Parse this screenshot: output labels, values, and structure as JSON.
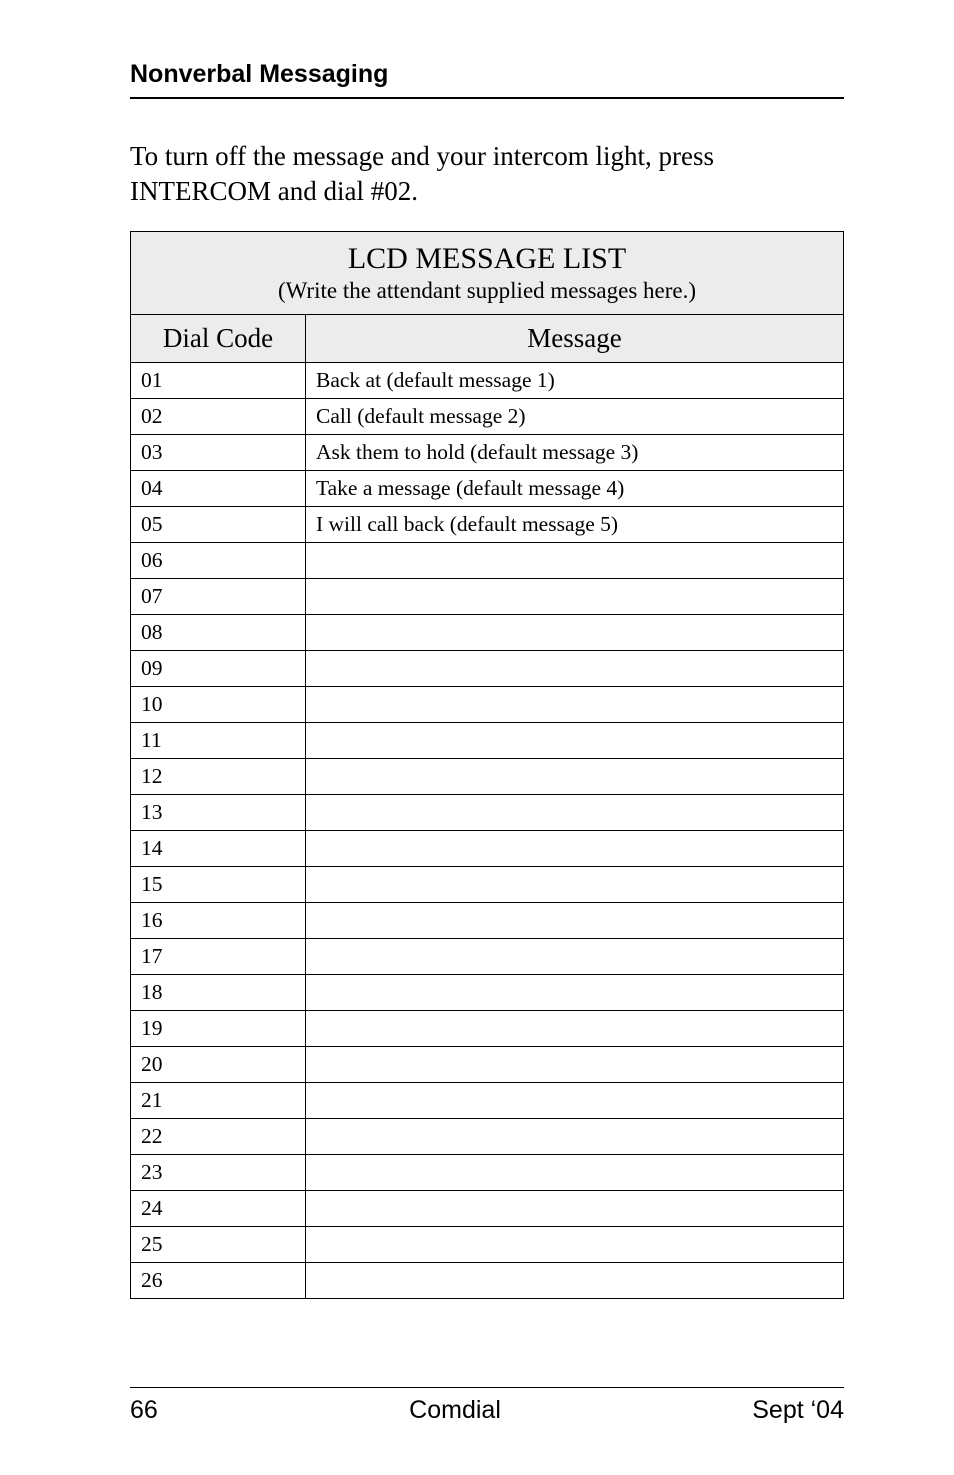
{
  "section_title": "Nonverbal Messaging",
  "intro_text": "To turn off the message and your intercom light, press INTERCOM and dial #02.",
  "table": {
    "title": "LCD MESSAGE LIST",
    "subtitle": "(Write the attendant supplied messages here.)",
    "headers": {
      "dial": "Dial Code",
      "message": "Message"
    },
    "rows": [
      {
        "code": "01",
        "msg": "Back at  (default message 1)"
      },
      {
        "code": "02",
        "msg": "Call  (default message 2)"
      },
      {
        "code": "03",
        "msg": "Ask them to hold  (default message 3)"
      },
      {
        "code": "04",
        "msg": "Take a message  (default message 4)"
      },
      {
        "code": "05",
        "msg": "I will call back  (default message 5)"
      },
      {
        "code": "06",
        "msg": ""
      },
      {
        "code": "07",
        "msg": ""
      },
      {
        "code": "08",
        "msg": ""
      },
      {
        "code": "09",
        "msg": ""
      },
      {
        "code": "10",
        "msg": ""
      },
      {
        "code": "11",
        "msg": ""
      },
      {
        "code": "12",
        "msg": ""
      },
      {
        "code": "13",
        "msg": ""
      },
      {
        "code": "14",
        "msg": ""
      },
      {
        "code": "15",
        "msg": ""
      },
      {
        "code": "16",
        "msg": ""
      },
      {
        "code": "17",
        "msg": ""
      },
      {
        "code": "18",
        "msg": ""
      },
      {
        "code": "19",
        "msg": ""
      },
      {
        "code": "20",
        "msg": ""
      },
      {
        "code": "21",
        "msg": ""
      },
      {
        "code": "22",
        "msg": ""
      },
      {
        "code": "23",
        "msg": ""
      },
      {
        "code": "24",
        "msg": ""
      },
      {
        "code": "25",
        "msg": ""
      },
      {
        "code": "26",
        "msg": ""
      }
    ]
  },
  "footer": {
    "page": "66",
    "center": "Comdial",
    "right": "Sept ‘04"
  }
}
